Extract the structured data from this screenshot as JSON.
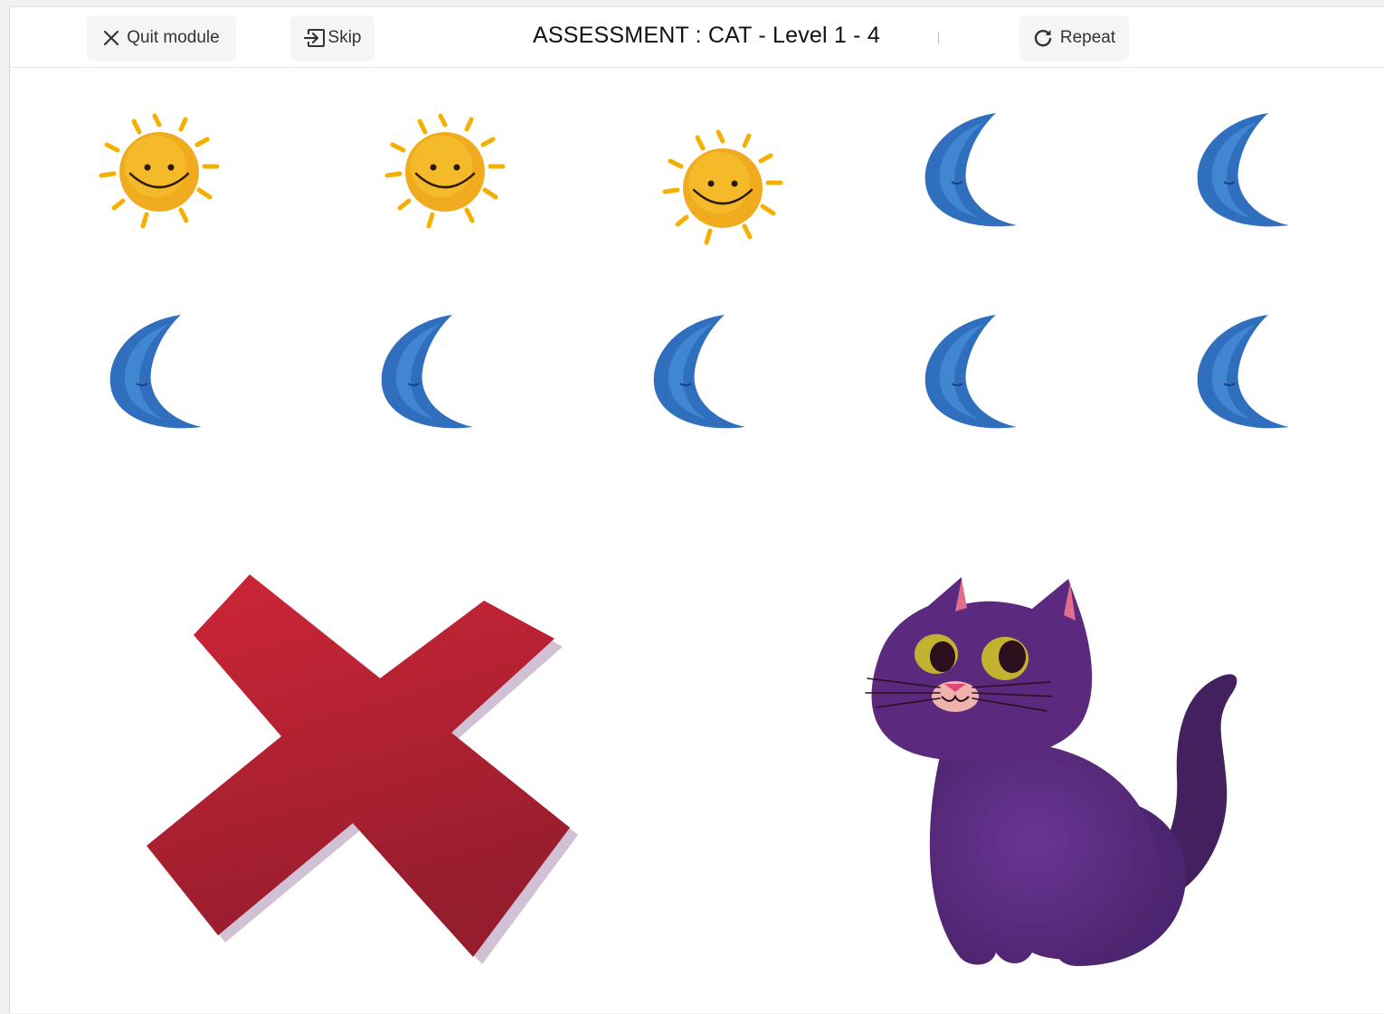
{
  "header": {
    "quit_label": "Quit module",
    "skip_label": "Skip",
    "title": "ASSESSMENT : CAT - Level 1 - 4",
    "repeat_label": "Repeat"
  },
  "icons": {
    "quit": "close-icon",
    "skip": "skip-icon",
    "repeat": "repeat-icon"
  },
  "stimuli": {
    "row1": [
      "sun",
      "sun",
      "sun",
      "moon",
      "moon"
    ],
    "row2": [
      "moon",
      "moon",
      "moon",
      "moon",
      "moon"
    ]
  },
  "answers": [
    "wrong-cross",
    "cat"
  ],
  "colors": {
    "cross": "#c0202f",
    "sun": "#f2b31e",
    "moon": "#2f6fbd",
    "cat": "#5b2a7e"
  }
}
